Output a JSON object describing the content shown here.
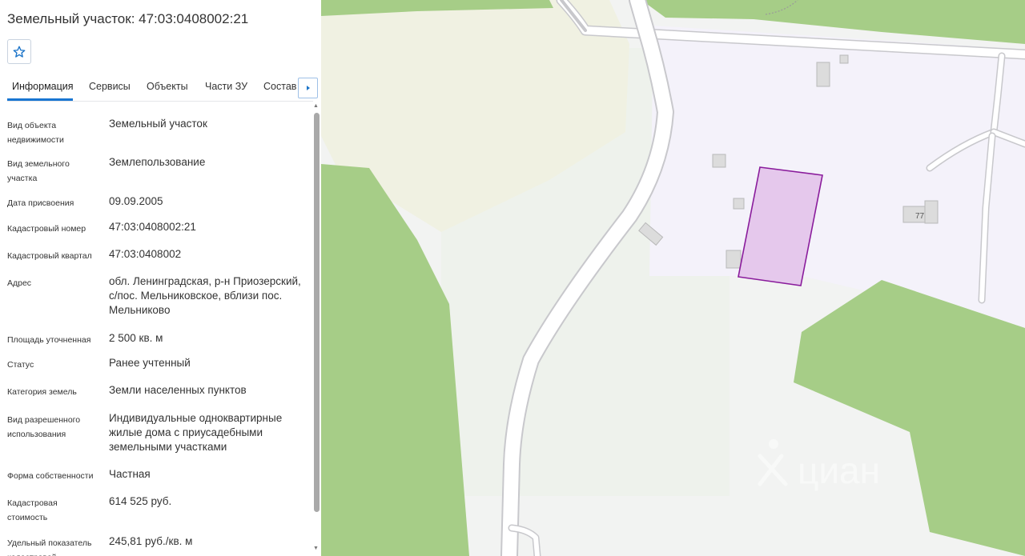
{
  "panel": {
    "title": "Земельный участок: 47:03:0408002:21",
    "favorite_icon": "star-outline-icon",
    "tabs": [
      "Информация",
      "Сервисы",
      "Объекты",
      "Части ЗУ",
      "Состав"
    ],
    "active_tab": "Информация",
    "tab_arrow_icon": "triangle-right-icon",
    "rows": [
      {
        "label": "Вид объекта недвижимости",
        "value": "Земельный участок"
      },
      {
        "label": "Вид земельного участка",
        "value": "Землепользование"
      },
      {
        "label": "Дата присвоения",
        "value": "09.09.2005"
      },
      {
        "label": "Кадастровый номер",
        "value": "47:03:0408002:21"
      },
      {
        "label": "Кадастровый квартал",
        "value": "47:03:0408002"
      },
      {
        "label": "Адрес",
        "value": "обл. Ленинградская, р-н Приозерский, с/пос. Мельниковское, вблизи пос. Мельниково"
      },
      {
        "label": "Площадь уточненная",
        "value": "2 500 кв. м"
      },
      {
        "label": "Статус",
        "value": "Ранее учтенный"
      },
      {
        "label": "Категория земель",
        "value": "Земли населенных пунктов"
      },
      {
        "label": "Вид разрешенного использования",
        "value": "Индивидуальные одноквартирные жилые дома с приусадебными земельными участками"
      },
      {
        "label": "Форма собственности",
        "value": "Частная"
      },
      {
        "label": "Кадастровая стоимость",
        "value": "614 525 руб."
      },
      {
        "label": "Удельный показатель кадастровой стоимости",
        "value": "245,81 руб./кв. м"
      }
    ]
  },
  "map": {
    "building_number": "77",
    "watermark": "циан",
    "colors": {
      "forest": "#a6cd87",
      "meadow": "#f0f1e2",
      "residential": "#f4f2fa",
      "ground": "#f2f3f2",
      "road_fill": "#ffffff",
      "road_edge": "#c8c8cc",
      "building": "#dcdcdc",
      "parcel_fill": "#e5c8ec",
      "parcel_stroke": "#8a1c9c"
    }
  }
}
